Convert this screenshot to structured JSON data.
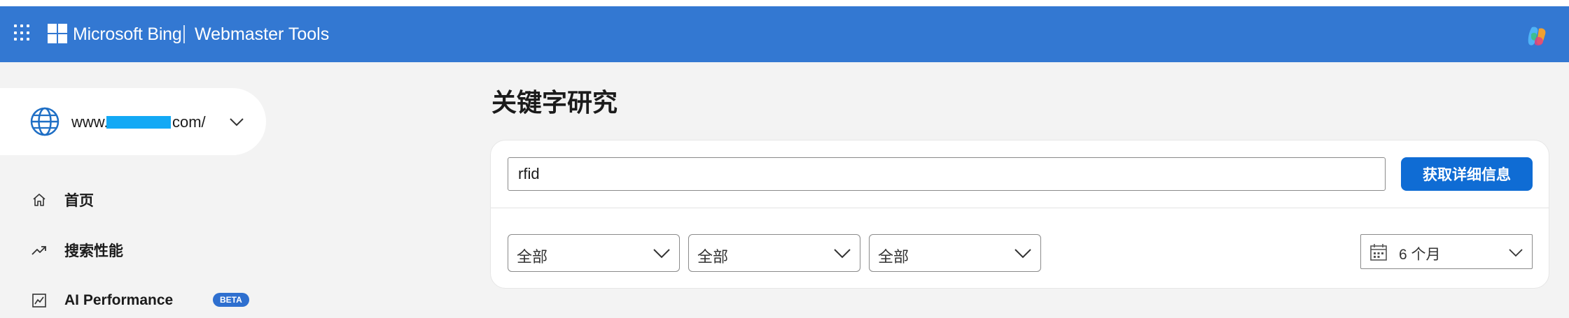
{
  "header": {
    "brand": "Microsoft Bing",
    "product": "Webmaster Tools",
    "background_color": "#3378d2"
  },
  "site_selector": {
    "url_prefix": "www.",
    "url_suffix": "com/"
  },
  "nav": {
    "items": [
      {
        "label": "首页",
        "icon": "home-icon"
      },
      {
        "label": "搜索性能",
        "icon": "trending-up-icon"
      },
      {
        "label": "AI Performance",
        "icon": "chart-frame-icon",
        "badge": "BETA"
      }
    ]
  },
  "main": {
    "title": "关键字研究",
    "keyword_input": {
      "value": "rfid"
    },
    "details_button": "获取详细信息",
    "filters": [
      {
        "label": "全部"
      },
      {
        "label": "全部"
      },
      {
        "label": "全部"
      }
    ],
    "date_range": "6 个月",
    "accent_color": "#0f6cd4"
  }
}
